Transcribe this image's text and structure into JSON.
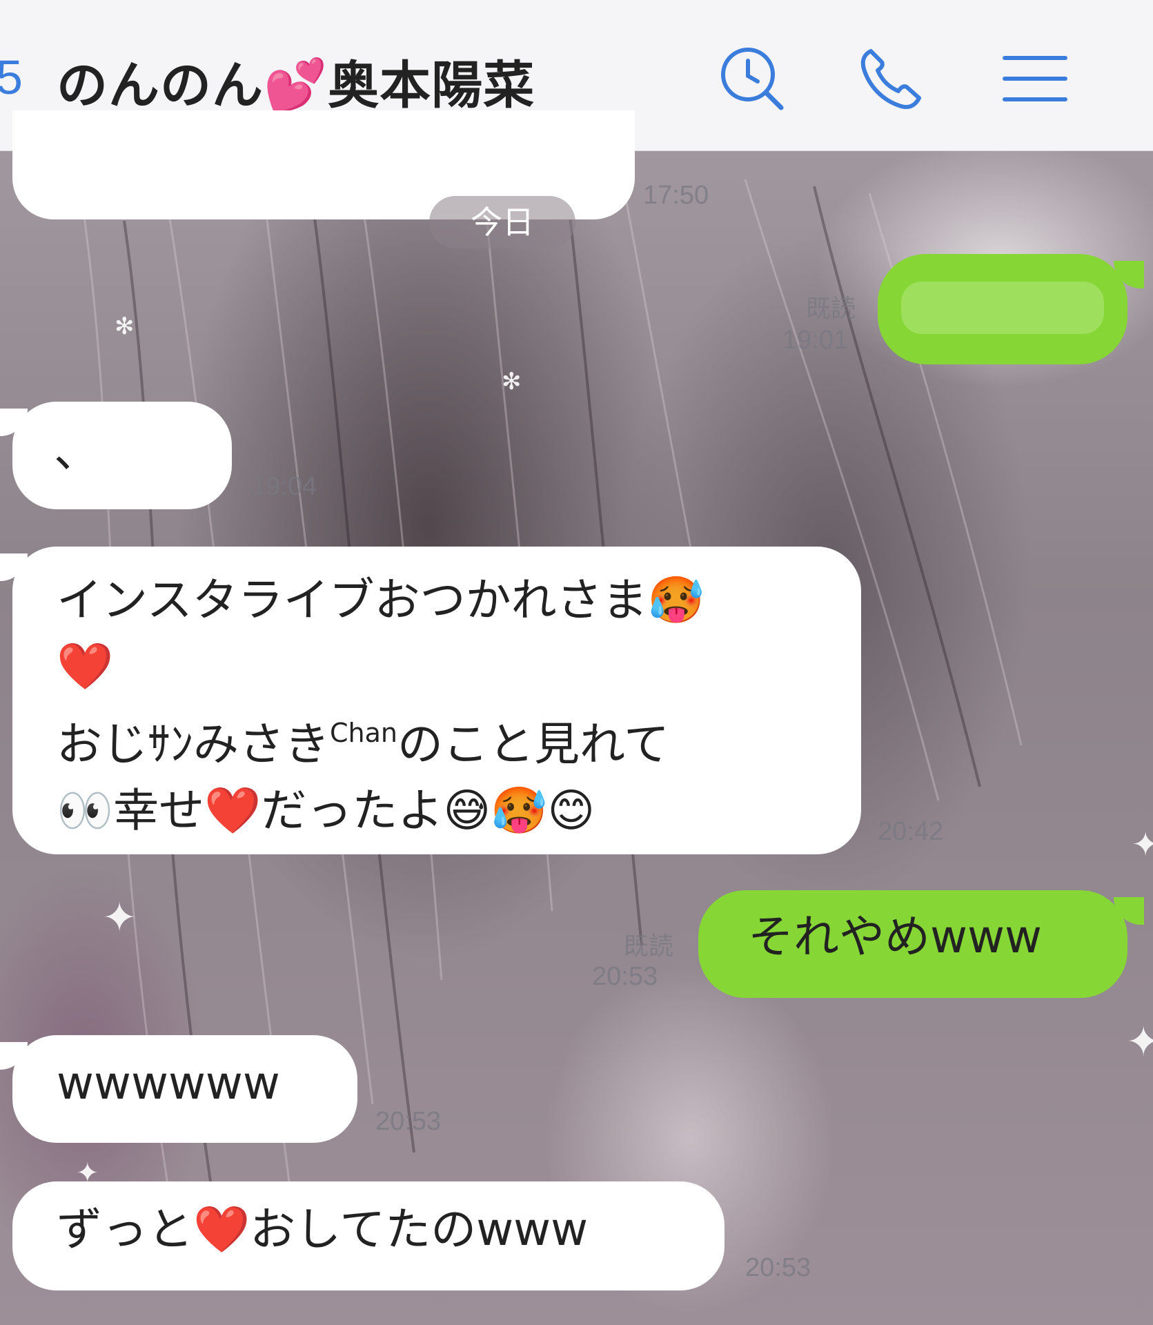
{
  "header": {
    "back_indicator": "5",
    "title": "のんのん💕奥本陽菜",
    "icons": [
      "history-search-icon",
      "phone-icon",
      "menu-icon"
    ],
    "accent_color": "#3b7ddd"
  },
  "date_separator": "今日",
  "messages": [
    {
      "direction": "in",
      "text": "",
      "time": "17:50"
    },
    {
      "direction": "out",
      "text": "",
      "read_label": "既読",
      "time": "19:01"
    },
    {
      "direction": "in",
      "text": "、",
      "time": "19:04"
    },
    {
      "direction": "in",
      "line1": "インスタライブおつかれさま🥵",
      "line2": "❤️",
      "line3_a": "おじｻﾝみさき",
      "line3_sup": "Chan",
      "line3_b": "のこと見れて",
      "line4": "👀幸せ❤️だったよ😅🥵😊",
      "time": "20:42"
    },
    {
      "direction": "out",
      "text": "それやめwww",
      "read_label": "既読",
      "time": "20:53"
    },
    {
      "direction": "in",
      "text": "wwwwww",
      "time": "20:53"
    },
    {
      "direction": "in",
      "text": "ずっと❤️おしてたのwww",
      "time": "20:53"
    }
  ],
  "colors": {
    "outgoing_bubble": "#86d635",
    "incoming_bubble": "#ffffff"
  }
}
